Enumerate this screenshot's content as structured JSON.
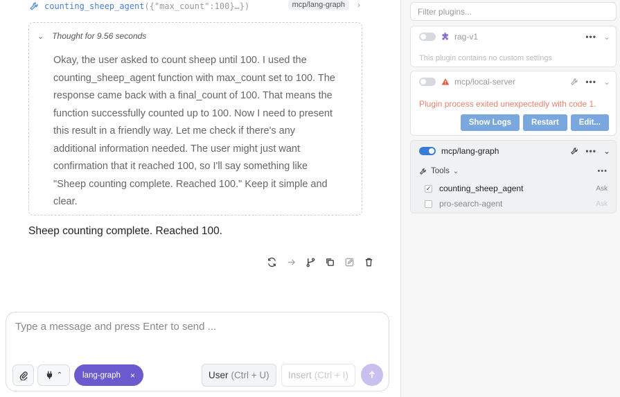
{
  "chat": {
    "tool_call": {
      "name": "counting_sheep_agent",
      "args": "({\"max_count\":100}…})",
      "tag": "mcp/lang-graph",
      "chevron": "›"
    },
    "thought": {
      "header": "Thought for 9.56 seconds",
      "body": "Okay, the user asked to count sheep until 100. I used the counting_sheep_agent function with max_count set to 100. The response came back with a final_count of 100. That means the function successfully counted up to 100. Now I need to present this result in a friendly way. Let me check if there's any additional information needed. The user might just want confirmation that it reached 100, so I'll say something like \"Sheep counting complete. Reached 100.\" Keep it simple and clear."
    },
    "answer": "Sheep counting complete. Reached 100.",
    "composer": {
      "placeholder": "Type a message and press Enter to send ...",
      "chip_label": "lang-graph",
      "chip_close": "×",
      "user_label": "User",
      "user_hint": "(Ctrl + U)",
      "insert_label": "Insert",
      "insert_hint": "(Ctrl + I)"
    }
  },
  "plugins": {
    "filter_placeholder": "Filter plugins...",
    "more": "•••",
    "rag": {
      "name": "rag-v1",
      "enabled": false,
      "note": "This plugin contains no custom settings"
    },
    "local": {
      "name": "mcp/local-server",
      "enabled": false,
      "error": "Plugin process exited unexpectedly with code 1.",
      "buttons": [
        "Show Logs",
        "Restart",
        "Edit..."
      ]
    },
    "langgraph": {
      "name": "mcp/lang-graph",
      "enabled": true,
      "tools_label": "Tools",
      "tools": [
        {
          "name": "counting_sheep_agent",
          "checked": true,
          "mode": "Ask"
        },
        {
          "name": "pro-search-agent",
          "checked": false,
          "mode": "Ask"
        }
      ]
    }
  },
  "colors": {
    "accent": "#3a7bd5",
    "chip": "#6a5acd",
    "error": "#e8826f",
    "button": "#7aa7dd",
    "puzzle": "#8a6fd1",
    "warning": "#e0553b"
  }
}
